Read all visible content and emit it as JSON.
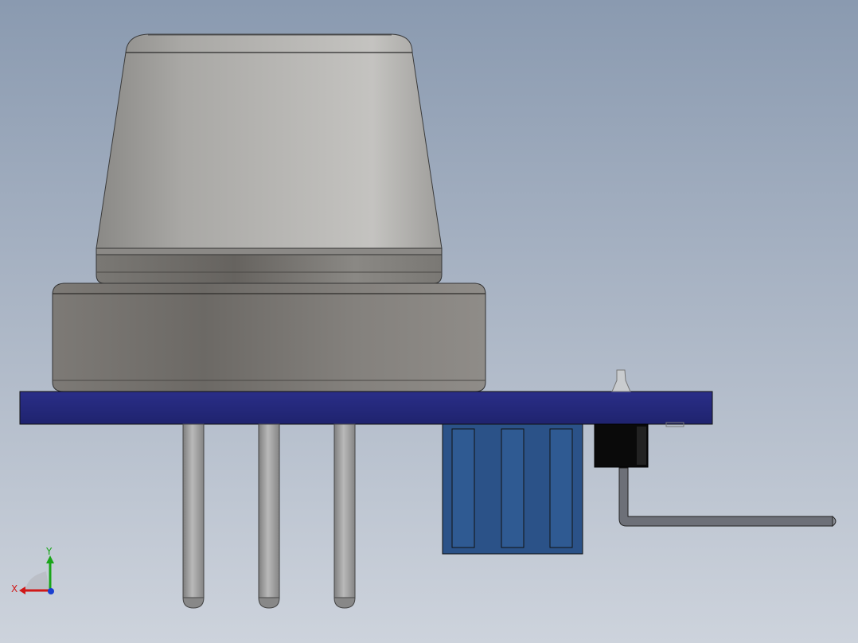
{
  "viewport": {
    "background_top": "#8a9ab0",
    "background_bottom": "#cdd3dc"
  },
  "model": {
    "sensor_color": "#8c8a86",
    "pcb_color": "#24287a",
    "connector_color": "#2b5288",
    "component_color": "#0a0a0a",
    "lead_color": "#9a9a9a"
  },
  "triad": {
    "y_label": "Y",
    "x_label": "X",
    "y_color": "#1aa51a",
    "x_color": "#d01818",
    "z_color": "#1a3fd0",
    "icon": "coordinate-triad-icon"
  }
}
